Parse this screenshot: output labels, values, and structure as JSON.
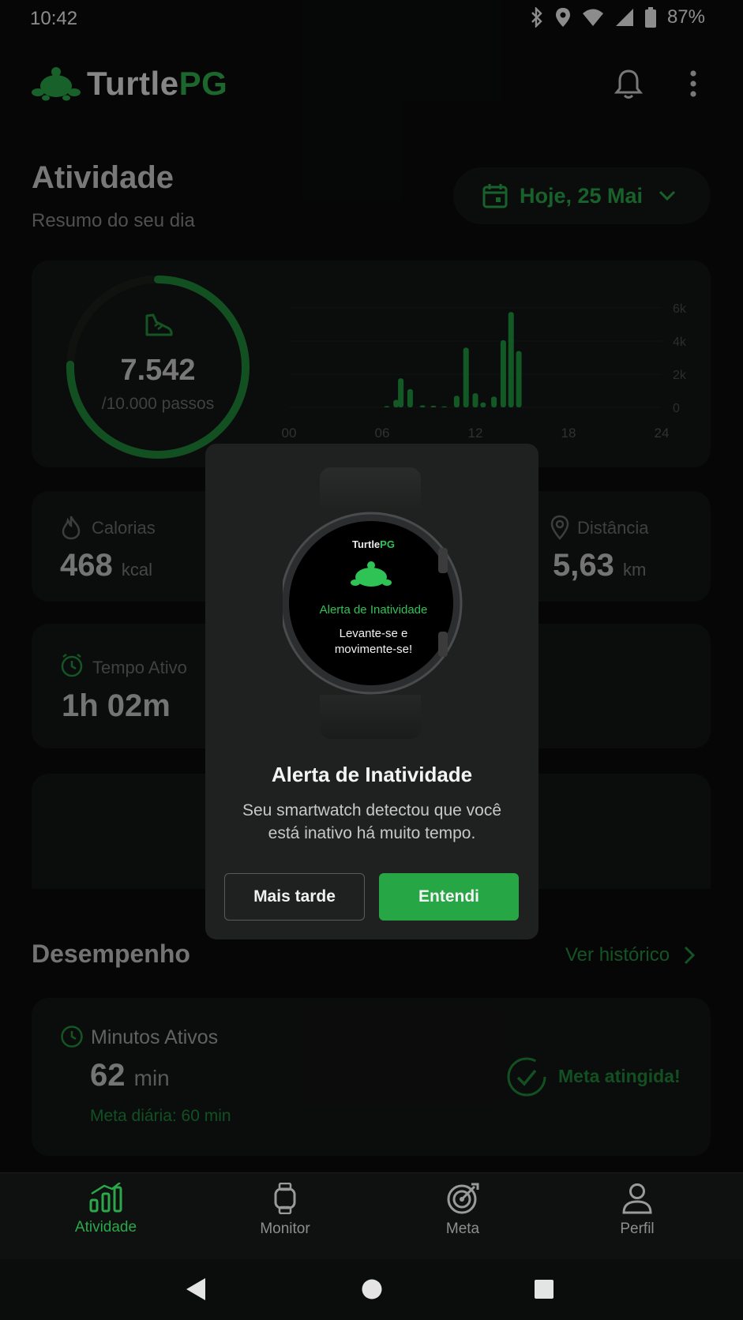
{
  "status_bar": {
    "time": "10:42",
    "battery": "87%"
  },
  "header": {
    "brand_part1": "Turtle",
    "brand_part2": "PG"
  },
  "page": {
    "title": "Atividade",
    "subtitle": "Resumo do seu dia",
    "date_label": "Hoje, 25 Mai"
  },
  "steps": {
    "value": "7.542",
    "goal_label": "/10.000 passos",
    "progress": 0.7542
  },
  "chart_data": {
    "type": "bar",
    "x_ticks": [
      "00",
      "06",
      "12",
      "18",
      "24"
    ],
    "y_ticks": [
      "0",
      "2k",
      "4k",
      "6k"
    ],
    "ylim": [
      0,
      6000
    ],
    "xlim": [
      0,
      24
    ],
    "bars": [
      {
        "x": 6.3,
        "y": 80
      },
      {
        "x": 6.9,
        "y": 450
      },
      {
        "x": 7.2,
        "y": 1750
      },
      {
        "x": 7.8,
        "y": 1100
      },
      {
        "x": 8.6,
        "y": 120
      },
      {
        "x": 9.3,
        "y": 100
      },
      {
        "x": 10.0,
        "y": 60
      },
      {
        "x": 10.8,
        "y": 700
      },
      {
        "x": 11.4,
        "y": 3600
      },
      {
        "x": 12.0,
        "y": 850
      },
      {
        "x": 12.5,
        "y": 300
      },
      {
        "x": 13.2,
        "y": 650
      },
      {
        "x": 13.8,
        "y": 4050
      },
      {
        "x": 14.3,
        "y": 5750
      },
      {
        "x": 14.8,
        "y": 3400
      }
    ]
  },
  "stats": {
    "calories": {
      "label": "Calorias",
      "value": "468",
      "unit": "kcal"
    },
    "distance": {
      "label": "Distância",
      "value": "5,63",
      "unit": "km"
    },
    "active_time": {
      "label": "Tempo Ativo",
      "value": "1h 02m"
    }
  },
  "performance": {
    "title": "Desempenho",
    "history_link": "Ver histórico",
    "minutes_label": "Minutos Ativos",
    "minutes_value": "62",
    "minutes_unit": "min",
    "daily_goal": "Meta diária: 60 min",
    "goal_status": "Meta atingida!"
  },
  "modal": {
    "watch_brand_1": "Turtle",
    "watch_brand_2": "PG",
    "watch_alert_title": "Alerta de Inatividade",
    "watch_alert_line1": "Levante-se e",
    "watch_alert_line2": "movimente-se!",
    "title": "Alerta de Inatividade",
    "body_line1": "Seu smartwatch detectou que você",
    "body_line2": "está inativo há muito tempo.",
    "later_label": "Mais tarde",
    "ok_label": "Entendi"
  },
  "nav": {
    "items": [
      {
        "label": "Atividade",
        "icon": "bar-chart-icon",
        "active": true
      },
      {
        "label": "Monitor",
        "icon": "watch-icon",
        "active": false
      },
      {
        "label": "Meta",
        "icon": "target-icon",
        "active": false
      },
      {
        "label": "Perfil",
        "icon": "user-icon",
        "active": false
      }
    ]
  },
  "colors": {
    "accent": "#2aa84a",
    "background": "#0b0c0c",
    "card": "#141515",
    "modal": "#1f2020"
  }
}
